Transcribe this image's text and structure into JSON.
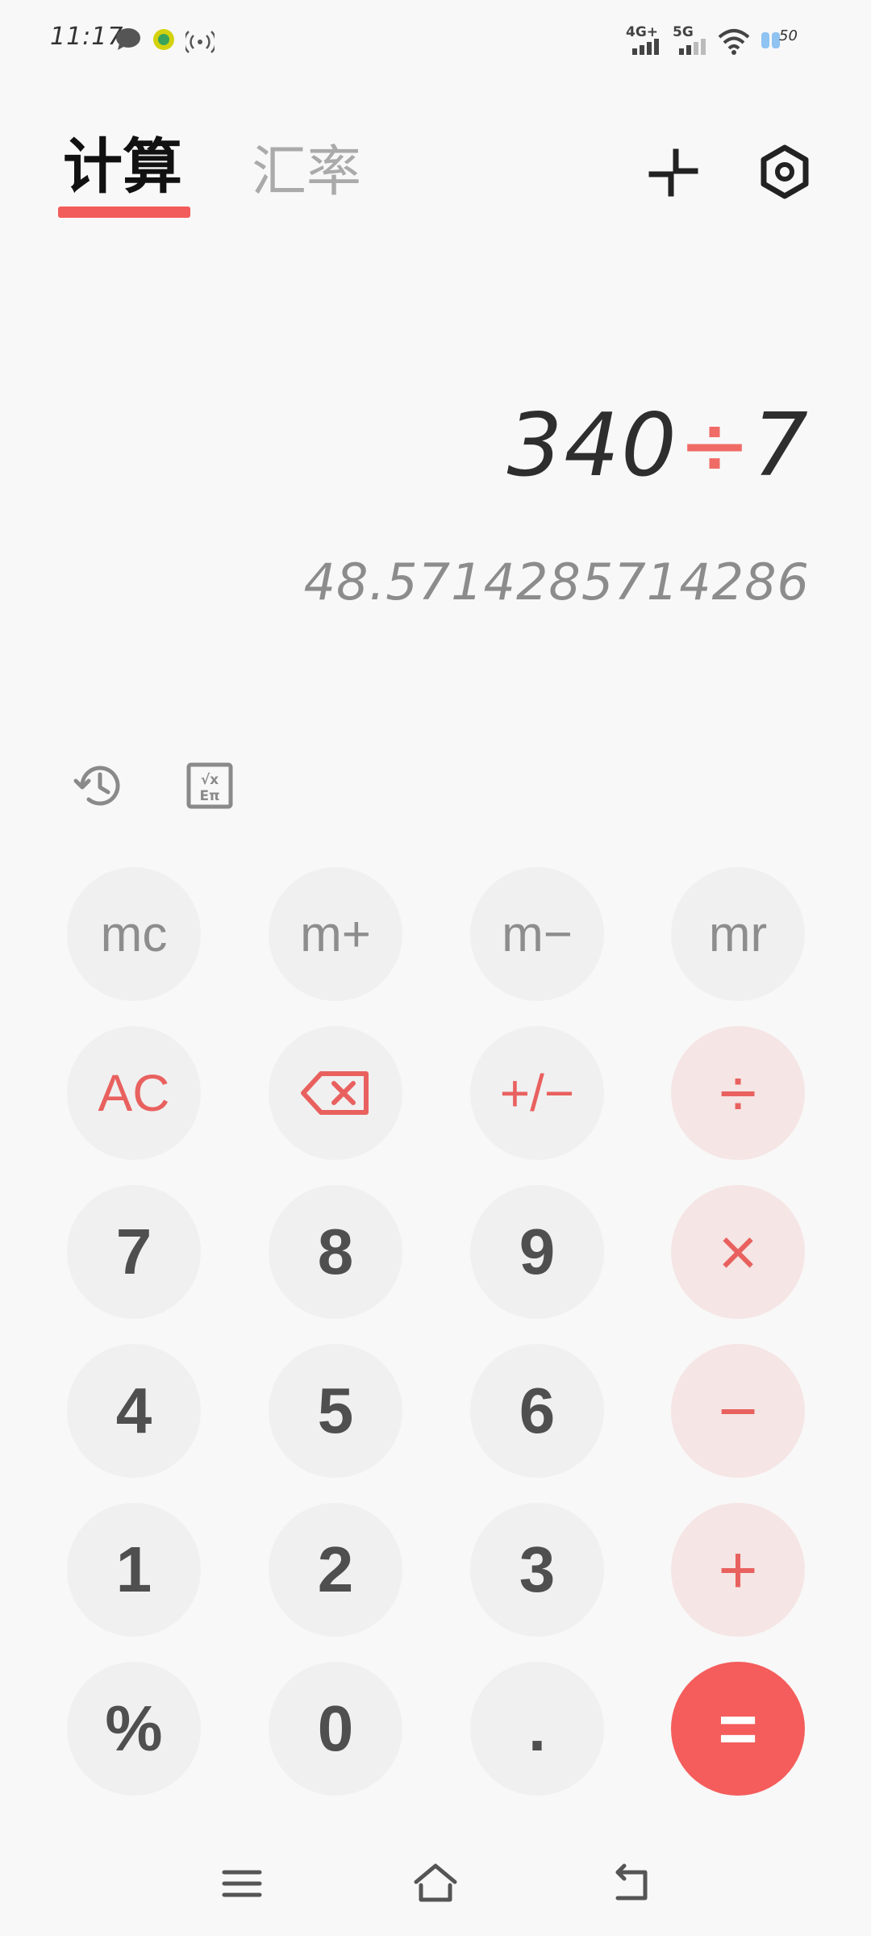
{
  "status_bar": {
    "time": "11:17",
    "network_1": "4G+",
    "network_2": "5G",
    "battery": "50",
    "icons": [
      "chat-bubble-icon",
      "app-notification-icon",
      "hotspot-icon",
      "signal-icon",
      "signal-icon",
      "wifi-icon",
      "battery-icon"
    ]
  },
  "header": {
    "tab_calculate": "计算",
    "tab_exchange_rate": "汇率",
    "icons": [
      "compact-mode-icon",
      "settings-icon"
    ]
  },
  "display": {
    "expr_left": "340",
    "expr_operator": "÷",
    "expr_right": "7",
    "result": "48.5714285714286"
  },
  "tools": {
    "icons": [
      "history-icon",
      "scientific-icon"
    ]
  },
  "keys": {
    "mc": "mc",
    "m_plus": "m+",
    "m_minus": "m−",
    "mr": "mr",
    "ac": "AC",
    "backspace": "",
    "plus_minus": "+/−",
    "divide": "÷",
    "seven": "7",
    "eight": "8",
    "nine": "9",
    "multiply": "×",
    "four": "4",
    "five": "5",
    "six": "6",
    "minus": "−",
    "one": "1",
    "two": "2",
    "three": "3",
    "plus": "+",
    "percent": "%",
    "zero": "0",
    "decimal": ".",
    "equals": "="
  },
  "nav_bar": {
    "icons": [
      "menu-icon",
      "home-icon",
      "back-icon"
    ]
  },
  "colors": {
    "accent": "#f25c5a",
    "operator_bg": "#f5e5e4",
    "key_bg": "#f0f0f0",
    "background": "#f8f8f8"
  }
}
